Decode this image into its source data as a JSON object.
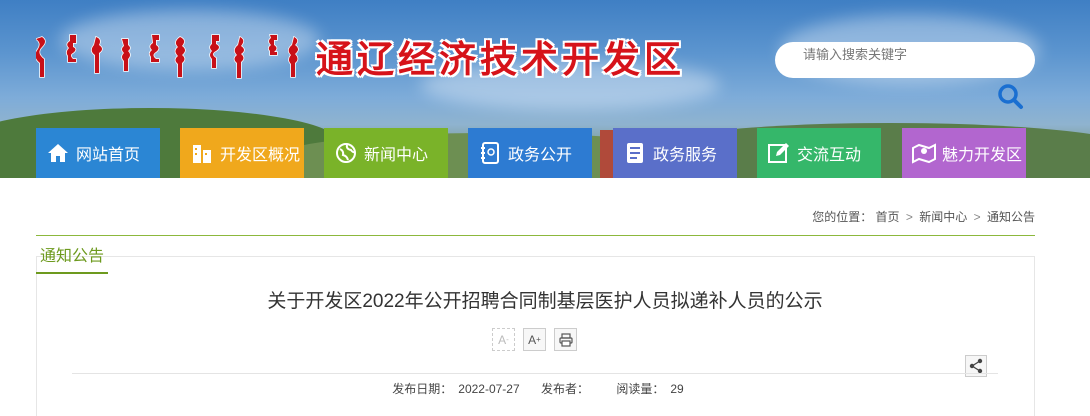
{
  "header": {
    "site_name": "通辽经济技术开发区",
    "mongol_icon": "mongolian-script-logo"
  },
  "search": {
    "placeholder": "请输入搜索关键字",
    "icon": "search-icon"
  },
  "nav": [
    {
      "label": "网站首页",
      "icon": "home-icon",
      "color": "#2b86d4"
    },
    {
      "label": "开发区概况",
      "icon": "buildings-icon",
      "color": "#f0a81c"
    },
    {
      "label": "新闻中心",
      "icon": "globe-icon",
      "color": "#7ab329"
    },
    {
      "label": "政务公开",
      "icon": "notebook-icon",
      "color": "#2d7bd2"
    },
    {
      "label": "政务服务",
      "icon": "document-icon",
      "color": "#5a6fc9"
    },
    {
      "label": "交流互动",
      "icon": "edit-icon",
      "color": "#35b76a"
    },
    {
      "label": "魅力开发区",
      "icon": "map-pin-icon",
      "color": "#b266cf"
    }
  ],
  "breadcrumb": {
    "prefix": "您的位置：",
    "items": [
      "首页",
      "新闻中心",
      "通知公告"
    ],
    "separator": ">"
  },
  "section": {
    "title": "通知公告"
  },
  "article": {
    "title": "关于开发区2022年公开招聘合同制基层医护人员拟递补人员的公示",
    "tools": {
      "font_smaller": "A",
      "font_larger": "A",
      "print_icon": "print-icon"
    },
    "share_icon": "share-icon",
    "meta": {
      "date_label": "发布日期：",
      "date": "2022-07-27",
      "publisher_label": "发布者：",
      "publisher": "",
      "views_label": "阅读量：",
      "views": "29"
    }
  }
}
